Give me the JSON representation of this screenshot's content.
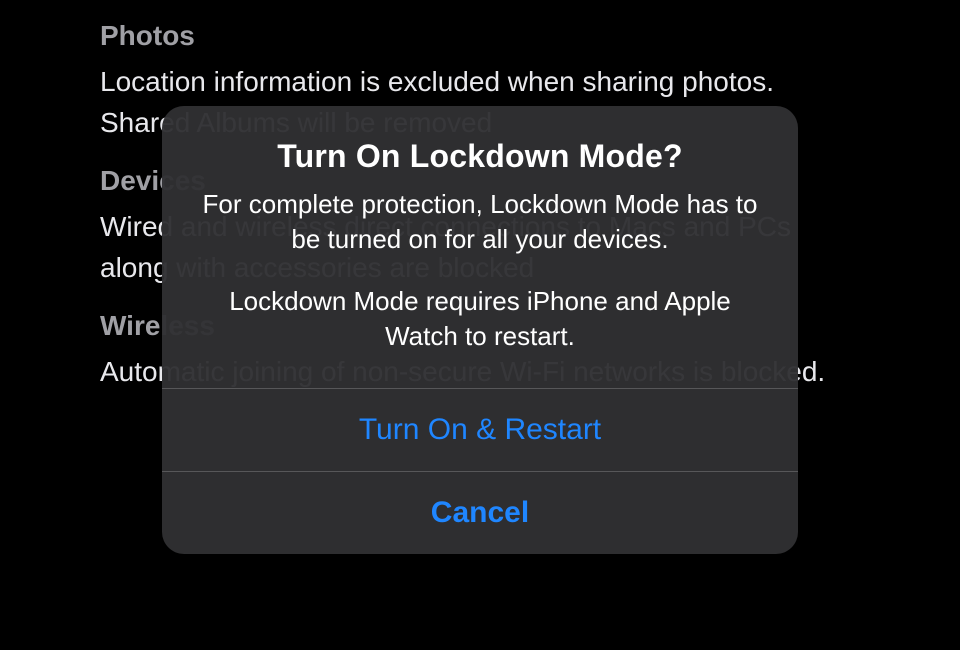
{
  "background": {
    "sections": [
      {
        "header": "Photos",
        "text": "Location information is excluded when sharing photos. Shared Albums will be removed"
      },
      {
        "header": "Devices",
        "text": "Wired and wireless direct connections to Macs and PCs along with accessories are blocked"
      },
      {
        "header": "Wireless",
        "text": "Automatic joining of non-secure Wi-Fi networks is blocked."
      }
    ]
  },
  "modal": {
    "title": "Turn On Lockdown Mode?",
    "message1": "For complete protection, Lockdown Mode has to be turned on for all your devices.",
    "message2": "Lockdown Mode requires iPhone and Apple Watch to restart.",
    "primaryAction": "Turn On & Restart",
    "cancelAction": "Cancel"
  }
}
